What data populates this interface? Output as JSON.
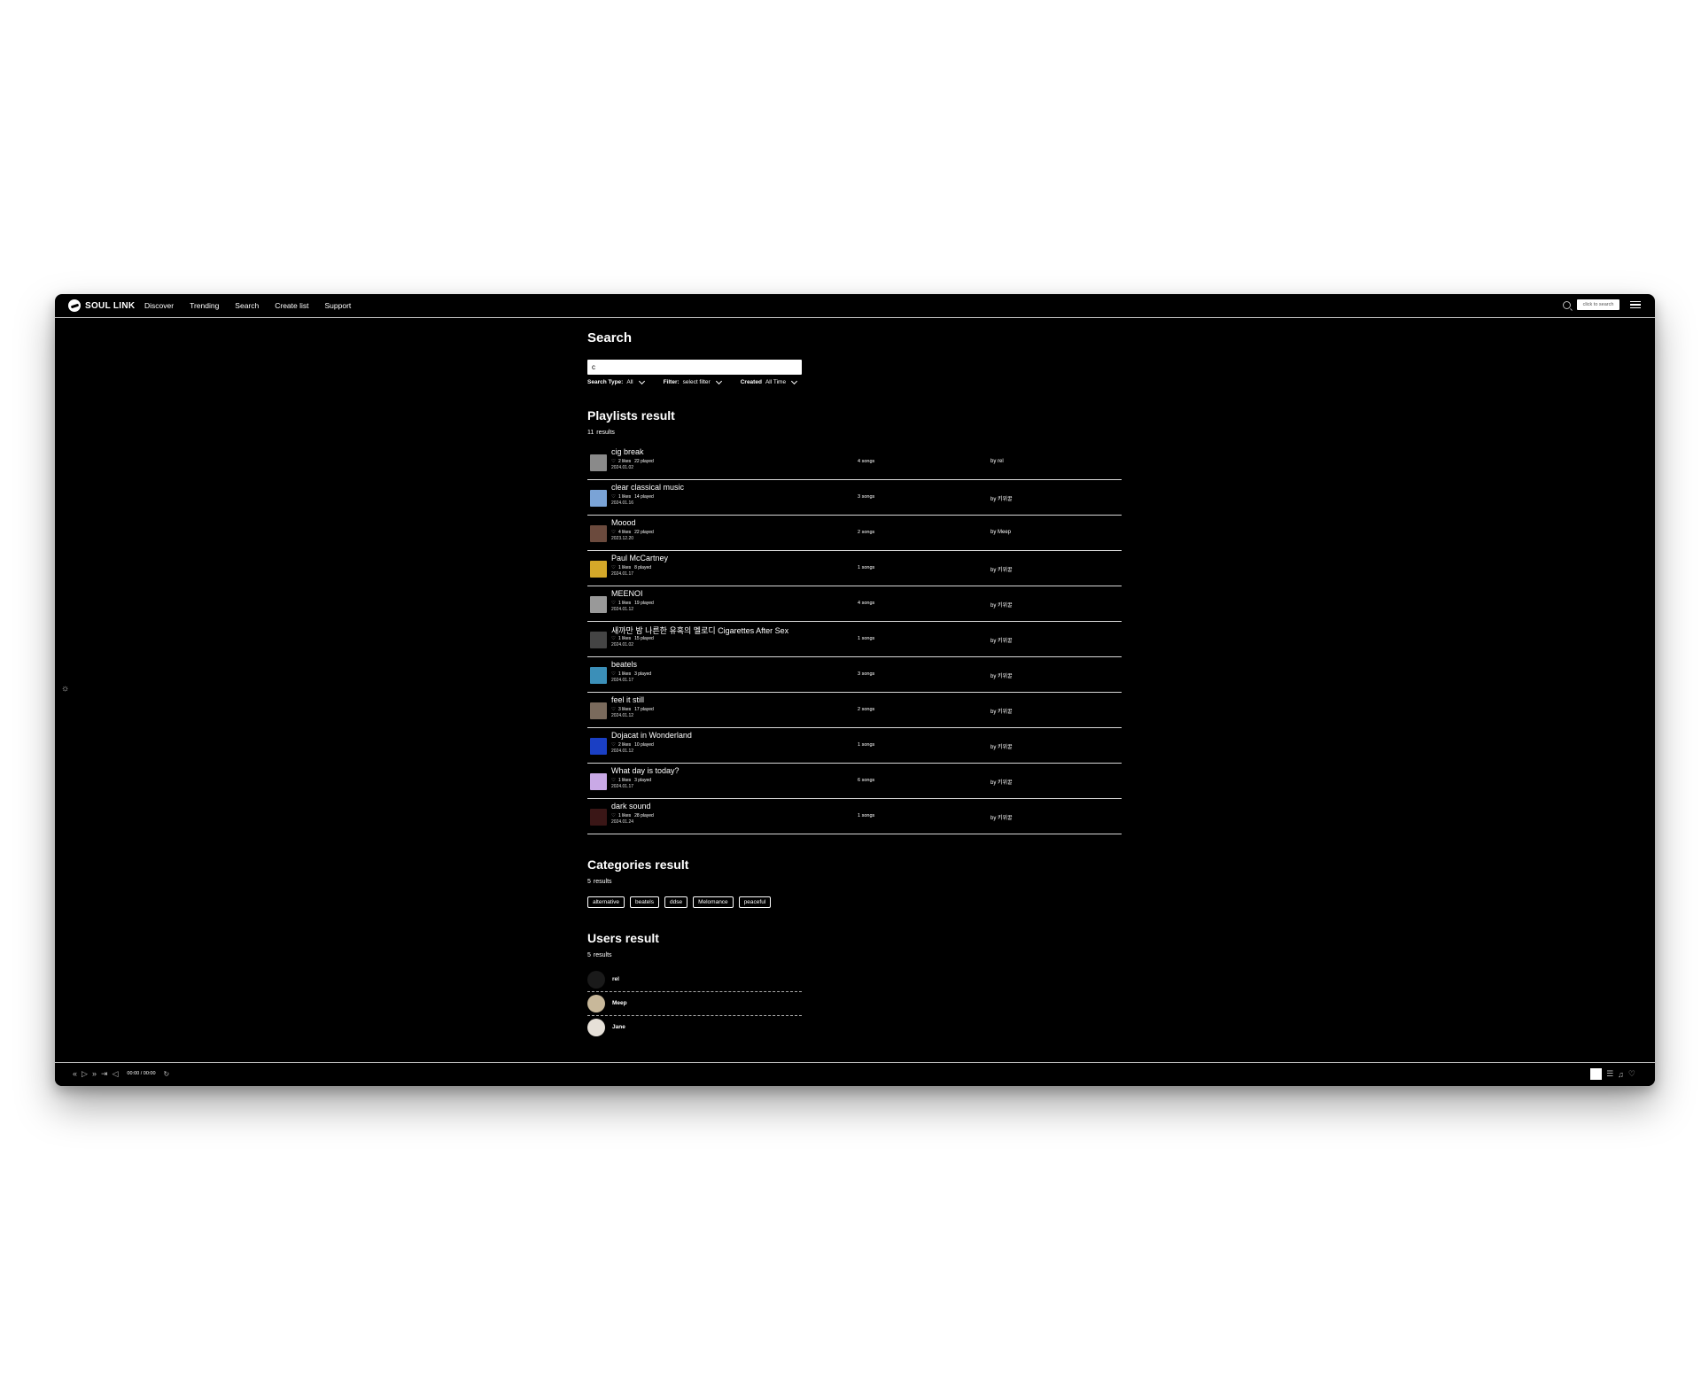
{
  "app": {
    "logo_text": "SOUL LINK",
    "nav": [
      {
        "label": "Discover"
      },
      {
        "label": "Trending"
      },
      {
        "label": "Search"
      },
      {
        "label": "Create list"
      },
      {
        "label": "Support"
      }
    ],
    "top_search_placeholder": "click to search"
  },
  "search": {
    "title": "Search",
    "query": "c",
    "filters": [
      {
        "label": "Search Type:",
        "value": "All"
      },
      {
        "label": "Filter:",
        "value": "select filter"
      },
      {
        "label": "Created",
        "value": "All Time"
      }
    ]
  },
  "playlists": {
    "title": "Playlists result",
    "count": "11",
    "count_suffix": "results",
    "items": [
      {
        "name": "cig break",
        "likes": "2 likes",
        "played": "22 played",
        "date": "2024.01.02",
        "songs": "4 songs",
        "by": "by rel",
        "thumb_color": "#8a8a8a"
      },
      {
        "name": "clear classical music",
        "likes": "1 likes",
        "played": "14 played",
        "date": "2024.01.16",
        "songs": "3 songs",
        "by": "by 키위꿀",
        "thumb_color": "#7aa3d6"
      },
      {
        "name": "Moood",
        "likes": "4 likes",
        "played": "22 played",
        "date": "2023.12.20",
        "songs": "2 songs",
        "by": "by Meep",
        "thumb_color": "#6b4a3d"
      },
      {
        "name": "Paul McCartney",
        "likes": "1 likes",
        "played": "8 played",
        "date": "2024.01.17",
        "songs": "1 songs",
        "by": "by 키위꿀",
        "thumb_color": "#d4a829"
      },
      {
        "name": "MEENOI",
        "likes": "1 likes",
        "played": "19 played",
        "date": "2024.01.12",
        "songs": "4 songs",
        "by": "by 키위꿀",
        "thumb_color": "#999999"
      },
      {
        "name": "새까만 밤 나른한 유혹의 멜로디 Cigarettes After Sex",
        "likes": "1 likes",
        "played": "15 played",
        "date": "2024.01.02",
        "songs": "1 songs",
        "by": "by 키위꿀",
        "thumb_color": "#444444"
      },
      {
        "name": "beatels",
        "likes": "1 likes",
        "played": "3 played",
        "date": "2024.01.17",
        "songs": "3 songs",
        "by": "by 키위꿀",
        "thumb_color": "#3b8fb8"
      },
      {
        "name": "feel it still",
        "likes": "3 likes",
        "played": "17 played",
        "date": "2024.01.12",
        "songs": "2 songs",
        "by": "by 키위꿀",
        "thumb_color": "#7a6a5c"
      },
      {
        "name": "Dojacat in Wonderland",
        "likes": "2 likes",
        "played": "10 played",
        "date": "2024.01.12",
        "songs": "1 songs",
        "by": "by 키위꿀",
        "thumb_color": "#1a3fc4"
      },
      {
        "name": "What day is today?",
        "likes": "1 likes",
        "played": "3 played",
        "date": "2024.01.17",
        "songs": "6 songs",
        "by": "by 키위꿀",
        "thumb_color": "#c9a9e6"
      },
      {
        "name": "dark sound",
        "likes": "1 likes",
        "played": "28 played",
        "date": "2024.01.24",
        "songs": "1 songs",
        "by": "by 키위꿀",
        "thumb_color": "#3a1616"
      }
    ]
  },
  "categories": {
    "title": "Categories result",
    "count": "5",
    "count_suffix": "results",
    "items": [
      "alternative",
      "beatels",
      "ddse",
      "Melomance",
      "peaceful"
    ]
  },
  "users": {
    "title": "Users result",
    "count": "5",
    "count_suffix": "results",
    "items": [
      {
        "name": "rel",
        "avatar_color": "#1a1a1a"
      },
      {
        "name": "Meep",
        "avatar_color": "#c8b89a"
      },
      {
        "name": "Jane",
        "avatar_color": "#e6e0d8"
      }
    ]
  },
  "player": {
    "time": "00:00 / 00:00"
  }
}
